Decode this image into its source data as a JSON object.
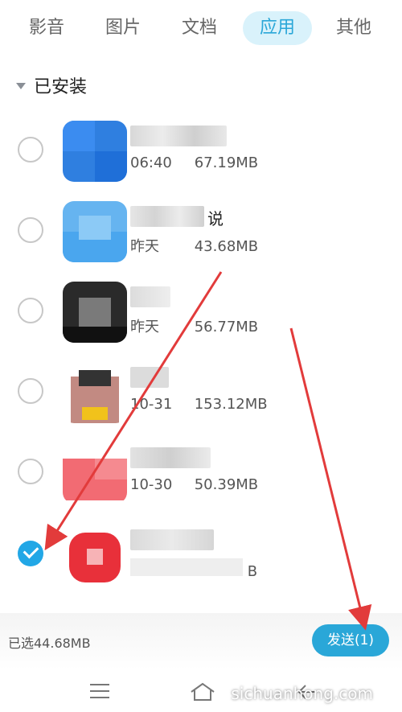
{
  "tabs": [
    "影音",
    "图片",
    "文档",
    "应用",
    "其他"
  ],
  "active_tab": "应用",
  "section": {
    "title": "已安装"
  },
  "apps": [
    {
      "name_suffix": "",
      "time": "06:40",
      "size": "67.19MB",
      "checked": false
    },
    {
      "name_suffix": "说",
      "time": "昨天",
      "size": "43.68MB",
      "checked": false
    },
    {
      "name_suffix": "",
      "time": "昨天",
      "size": "56.77MB",
      "checked": false
    },
    {
      "name_suffix": "",
      "time": "10-31",
      "size": "153.12MB",
      "checked": false
    },
    {
      "name_suffix": "",
      "time": "10-30",
      "size": "50.39MB",
      "checked": false
    },
    {
      "name_suffix": "",
      "time": "",
      "size": "B",
      "checked": true
    }
  ],
  "footer": {
    "selected_text": "已选44.68MB",
    "send_label": "发送(1)"
  },
  "watermark": "sichuanhong.com",
  "colors": {
    "accent": "#2aa7d8",
    "arrow": "#e23b3b"
  },
  "nav_icons": [
    "menu-icon",
    "home-icon",
    "back-icon"
  ]
}
